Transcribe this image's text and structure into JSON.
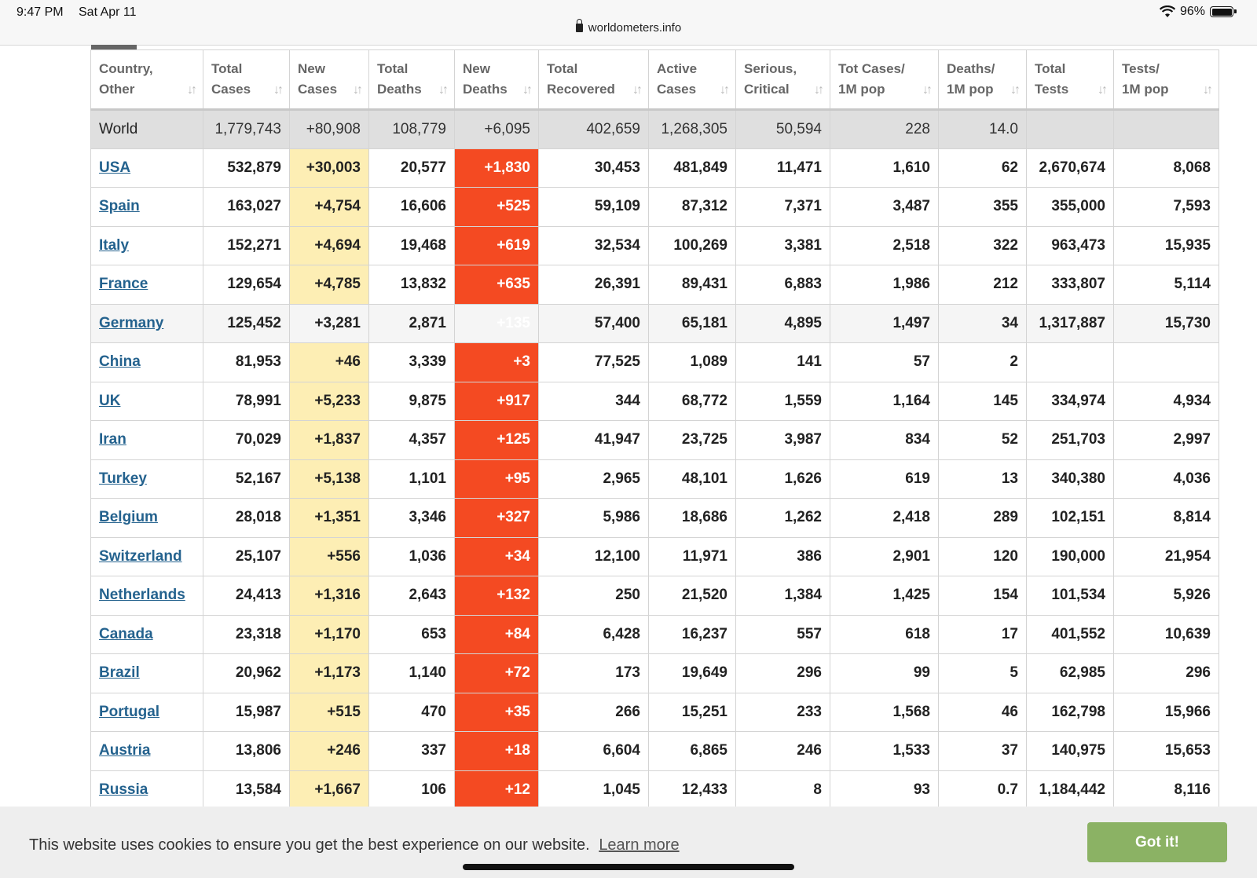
{
  "status_bar": {
    "time": "9:47 PM",
    "date": "Sat Apr 11",
    "url": "worldometers.info",
    "battery": "96%"
  },
  "table": {
    "headers": [
      {
        "line1": "Country,",
        "line2": "Other"
      },
      {
        "line1": "Total",
        "line2": "Cases"
      },
      {
        "line1": "New",
        "line2": "Cases"
      },
      {
        "line1": "Total",
        "line2": "Deaths"
      },
      {
        "line1": "New",
        "line2": "Deaths"
      },
      {
        "line1": "Total",
        "line2": "Recovered"
      },
      {
        "line1": "Active",
        "line2": "Cases"
      },
      {
        "line1": "Serious,",
        "line2": "Critical"
      },
      {
        "line1": "Tot Cases/",
        "line2": "1M pop"
      },
      {
        "line1": "Deaths/",
        "line2": "1M pop"
      },
      {
        "line1": "Total",
        "line2": "Tests"
      },
      {
        "line1": "Tests/",
        "line2": "1M pop"
      }
    ],
    "world": [
      "World",
      "1,779,743",
      "+80,908",
      "108,779",
      "+6,095",
      "402,659",
      "1,268,305",
      "50,594",
      "228",
      "14.0",
      "",
      ""
    ],
    "rows": [
      [
        "USA",
        "532,879",
        "+30,003",
        "20,577",
        "+1,830",
        "30,453",
        "481,849",
        "11,471",
        "1,610",
        "62",
        "2,670,674",
        "8,068"
      ],
      [
        "Spain",
        "163,027",
        "+4,754",
        "16,606",
        "+525",
        "59,109",
        "87,312",
        "7,371",
        "3,487",
        "355",
        "355,000",
        "7,593"
      ],
      [
        "Italy",
        "152,271",
        "+4,694",
        "19,468",
        "+619",
        "32,534",
        "100,269",
        "3,381",
        "2,518",
        "322",
        "963,473",
        "15,935"
      ],
      [
        "France",
        "129,654",
        "+4,785",
        "13,832",
        "+635",
        "26,391",
        "89,431",
        "6,883",
        "1,986",
        "212",
        "333,807",
        "5,114"
      ],
      [
        "Germany",
        "125,452",
        "+3,281",
        "2,871",
        "+135",
        "57,400",
        "65,181",
        "4,895",
        "1,497",
        "34",
        "1,317,887",
        "15,730"
      ],
      [
        "China",
        "81,953",
        "+46",
        "3,339",
        "+3",
        "77,525",
        "1,089",
        "141",
        "57",
        "2",
        "",
        ""
      ],
      [
        "UK",
        "78,991",
        "+5,233",
        "9,875",
        "+917",
        "344",
        "68,772",
        "1,559",
        "1,164",
        "145",
        "334,974",
        "4,934"
      ],
      [
        "Iran",
        "70,029",
        "+1,837",
        "4,357",
        "+125",
        "41,947",
        "23,725",
        "3,987",
        "834",
        "52",
        "251,703",
        "2,997"
      ],
      [
        "Turkey",
        "52,167",
        "+5,138",
        "1,101",
        "+95",
        "2,965",
        "48,101",
        "1,626",
        "619",
        "13",
        "340,380",
        "4,036"
      ],
      [
        "Belgium",
        "28,018",
        "+1,351",
        "3,346",
        "+327",
        "5,986",
        "18,686",
        "1,262",
        "2,418",
        "289",
        "102,151",
        "8,814"
      ],
      [
        "Switzerland",
        "25,107",
        "+556",
        "1,036",
        "+34",
        "12,100",
        "11,971",
        "386",
        "2,901",
        "120",
        "190,000",
        "21,954"
      ],
      [
        "Netherlands",
        "24,413",
        "+1,316",
        "2,643",
        "+132",
        "250",
        "21,520",
        "1,384",
        "1,425",
        "154",
        "101,534",
        "5,926"
      ],
      [
        "Canada",
        "23,318",
        "+1,170",
        "653",
        "+84",
        "6,428",
        "16,237",
        "557",
        "618",
        "17",
        "401,552",
        "10,639"
      ],
      [
        "Brazil",
        "20,962",
        "+1,173",
        "1,140",
        "+72",
        "173",
        "19,649",
        "296",
        "99",
        "5",
        "62,985",
        "296"
      ],
      [
        "Portugal",
        "15,987",
        "+515",
        "470",
        "+35",
        "266",
        "15,251",
        "233",
        "1,568",
        "46",
        "162,798",
        "15,966"
      ],
      [
        "Austria",
        "13,806",
        "+246",
        "337",
        "+18",
        "6,604",
        "6,865",
        "246",
        "1,533",
        "37",
        "140,975",
        "15,653"
      ],
      [
        "Russia",
        "13,584",
        "+1,667",
        "106",
        "+12",
        "1,045",
        "12,433",
        "8",
        "93",
        "0.7",
        "1,184,442",
        "8,116"
      ]
    ]
  },
  "cookie_banner": {
    "message": "This website uses cookies to ensure you get the best experience on our website.",
    "learn_more": "Learn more",
    "accept": "Got it!"
  },
  "colors": {
    "new_cases_bg": "#fdeeb4",
    "new_deaths_bg": "#f44a22",
    "link": "#24628e",
    "accept_button": "#8bb264"
  },
  "icons": [
    "lock-icon",
    "wifi-icon",
    "battery-icon",
    "sort-icon"
  ]
}
